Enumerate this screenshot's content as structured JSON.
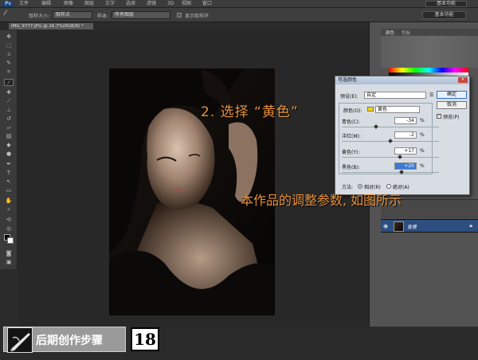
{
  "app": {
    "logo": "Ps",
    "menu": [
      "文件",
      "编辑",
      "图像",
      "图层",
      "文字",
      "选择",
      "滤镜",
      "3D",
      "视图",
      "窗口"
    ],
    "workspace": "基本功能"
  },
  "options": {
    "brush_size_label": "取样大小:",
    "brush_size_value": "取样点",
    "sample_label": "样本:",
    "sample_value": "所有图层",
    "show_ring_label": "显示取样环",
    "workspace": "基本功能"
  },
  "document": {
    "tab_title": "IMG_9777.JPG @ 16.7%(RGB/8) *"
  },
  "panels": {
    "color_tab": "颜色",
    "swatch_tab": "色板",
    "layer_name": "背景"
  },
  "dialog": {
    "title": "可选颜色",
    "preset_label": "预设(E):",
    "preset_value": "自定",
    "ok": "确定",
    "cancel": "取消",
    "preview_label": "预览(P)",
    "colors_label": "颜色(O):",
    "colors_value": "黄色",
    "rows": [
      {
        "label": "青色(C):",
        "value": "-34",
        "unit": "%"
      },
      {
        "label": "洋红(M):",
        "value": "-2",
        "unit": "%"
      },
      {
        "label": "黄色(Y):",
        "value": "+17",
        "unit": "%"
      },
      {
        "label": "黑色(B):",
        "value": "+20",
        "unit": "%"
      }
    ],
    "method_label": "方法:",
    "method_relative": "相对(R)",
    "method_absolute": "绝对(A)"
  },
  "annotations": {
    "step": "2. 选择 “黄色”",
    "note": "本作品的调整参数, 如图所示"
  },
  "footer": {
    "banner": "后期创作步骤",
    "number": "18"
  },
  "colors": {
    "accent": "#e8913a",
    "layer_selected": "#2d4f80",
    "yellow_swatch": "#ffd400"
  }
}
